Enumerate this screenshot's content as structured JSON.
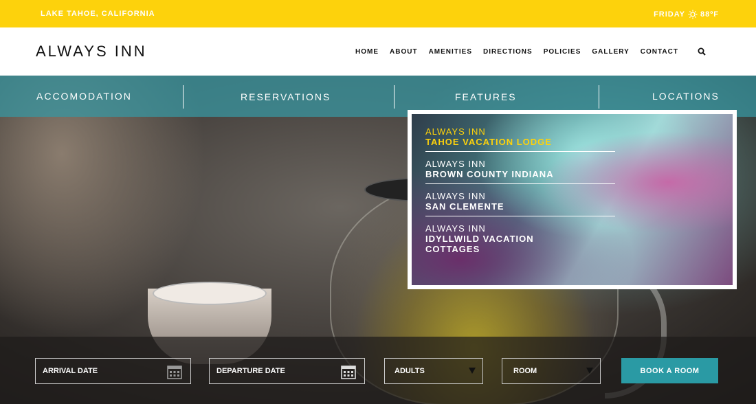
{
  "topbar": {
    "location": "LAKE TAHOE, CALIFORNIA",
    "day": "FRIDAY",
    "temperature": "88ºF",
    "weather_icon": "sun-icon"
  },
  "header": {
    "logo": "ALWAYS INN",
    "nav": [
      "HOME",
      "ABOUT",
      "AMENITIES",
      "DIRECTIONS",
      "POLICIES",
      "GALLERY",
      "CONTACT"
    ],
    "search_icon": "search-icon"
  },
  "subnav": [
    "ACCOMODATION",
    "RESERVATIONS",
    "FEATURES",
    "LOCATIONS"
  ],
  "locations": [
    {
      "brand": "ALWAYS INN",
      "name": "TAHOE VACATION LODGE",
      "active": true
    },
    {
      "brand": "ALWAYS INN",
      "name": "BROWN COUNTY INDIANA",
      "active": false
    },
    {
      "brand": "ALWAYS INN",
      "name": "SAN CLEMENTE",
      "active": false
    },
    {
      "brand": "ALWAYS INN",
      "name": "IDYLLWILD VACATION COTTAGES",
      "active": false
    }
  ],
  "booking": {
    "arrival": "ARRIVAL DATE",
    "departure": "DEPARTURE DATE",
    "adults": "ADULTS",
    "room": "ROOM",
    "button": "BOOK A ROOM"
  },
  "colors": {
    "accent_yellow": "#fdd20c",
    "accent_teal": "#2a9aa4"
  }
}
